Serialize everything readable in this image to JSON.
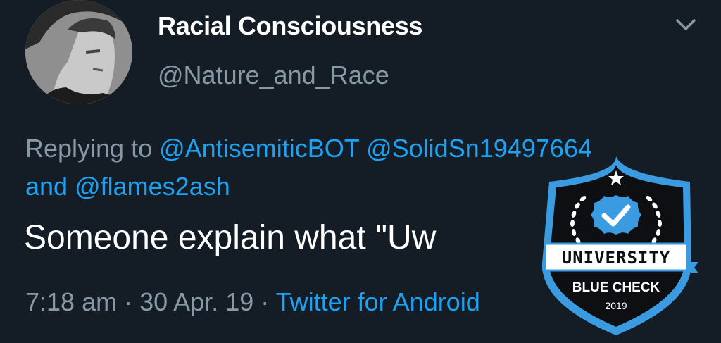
{
  "author": {
    "display_name": "Racial Consciousness",
    "handle": "@Nature_and_Race"
  },
  "reply": {
    "prefix": "Replying to",
    "mention1": "@AntisemiticBOT",
    "mention2": "@SolidSn19497664",
    "joiner": "and",
    "mention3": "@flames2ash"
  },
  "tweet": {
    "text": "Someone explain what \"Uw",
    "time": "7:18 am",
    "separator": "·",
    "date": "30 Apr. 19",
    "source": "Twitter for Android"
  },
  "badge": {
    "title": "UNIVERSITY",
    "subtitle": "BLUE CHECK",
    "year": "2019"
  },
  "colors": {
    "background": "#141d26",
    "text": "#ffffff",
    "muted": "#8899a6",
    "link": "#1da1f2",
    "badge_blue": "#3b9be0"
  },
  "icons": {
    "menu": "chevron-down-icon",
    "check": "verified-check-icon"
  }
}
